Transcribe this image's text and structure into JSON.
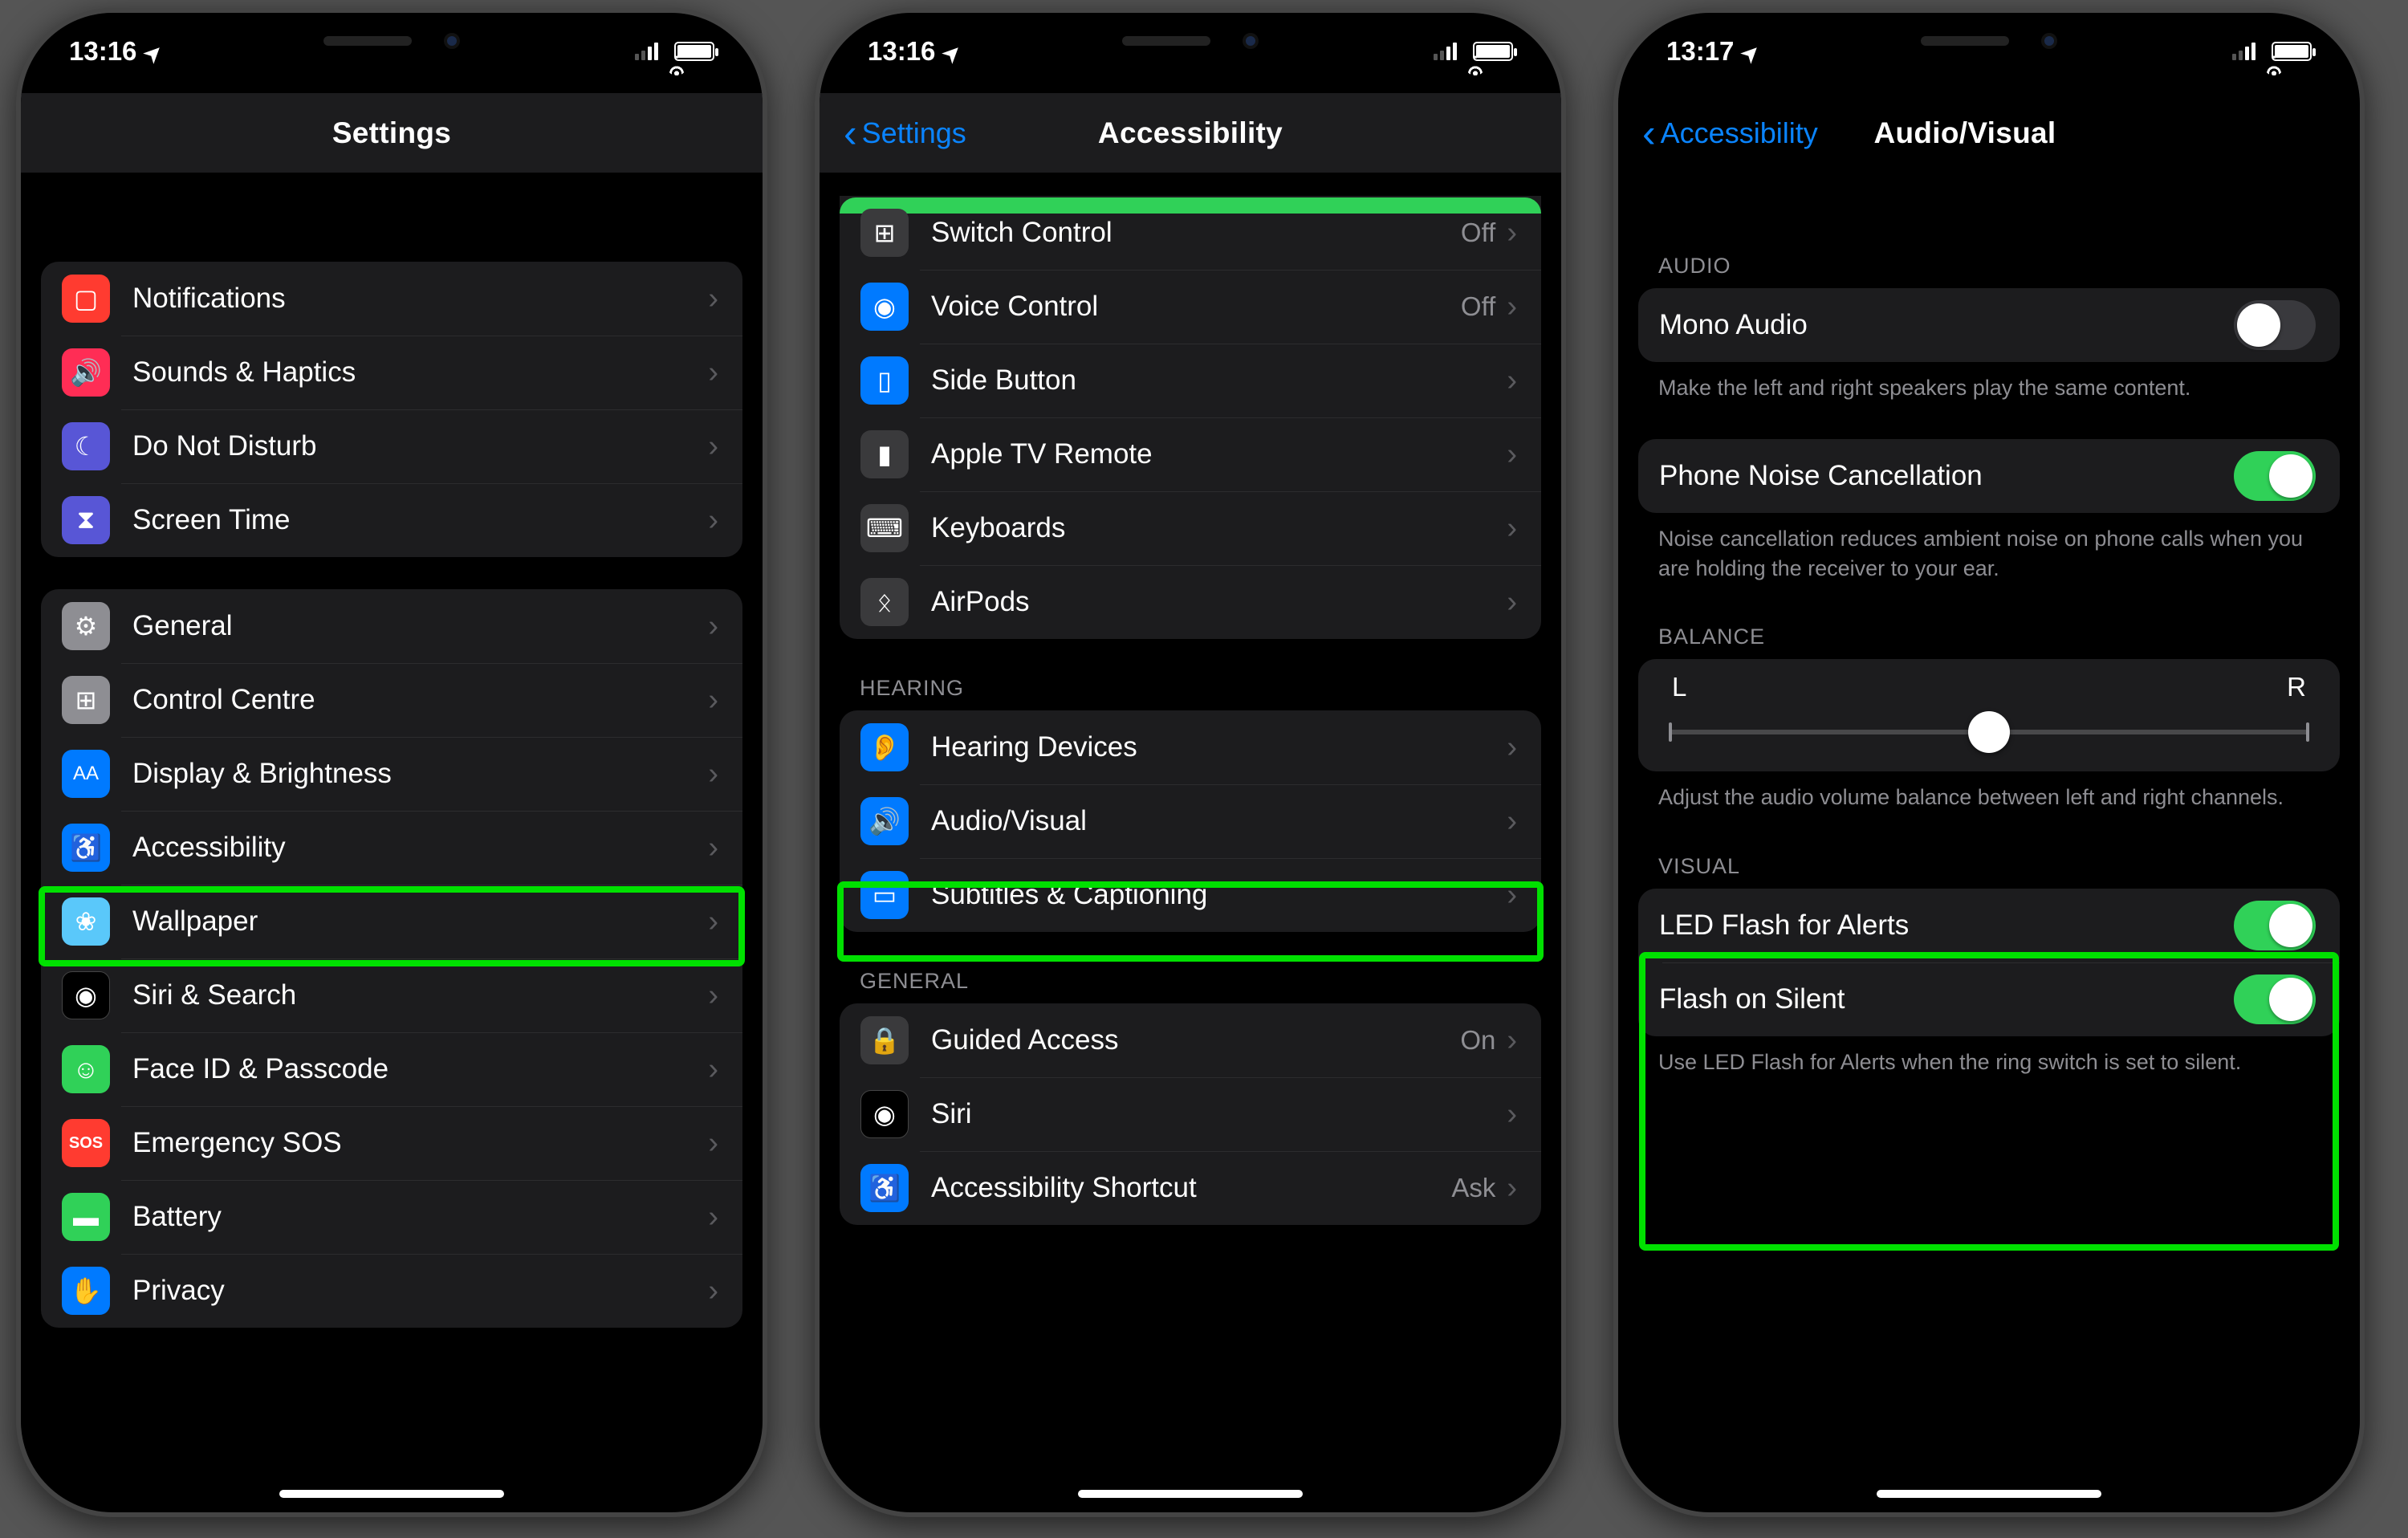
{
  "status": {
    "time1": "13:16",
    "time2": "13:16",
    "time3": "13:17"
  },
  "screen1": {
    "title": "Settings",
    "g1": [
      {
        "label": "Notifications"
      },
      {
        "label": "Sounds & Haptics"
      },
      {
        "label": "Do Not Disturb"
      },
      {
        "label": "Screen Time"
      }
    ],
    "g2": [
      {
        "label": "General"
      },
      {
        "label": "Control Centre"
      },
      {
        "label": "Display & Brightness"
      },
      {
        "label": "Accessibility"
      },
      {
        "label": "Wallpaper"
      },
      {
        "label": "Siri & Search"
      },
      {
        "label": "Face ID & Passcode"
      },
      {
        "label": "Emergency SOS"
      },
      {
        "label": "Battery"
      },
      {
        "label": "Privacy"
      }
    ]
  },
  "screen2": {
    "back": "Settings",
    "title": "Accessibility",
    "g1": [
      {
        "label": "Switch Control",
        "value": "Off"
      },
      {
        "label": "Voice Control",
        "value": "Off"
      },
      {
        "label": "Side Button"
      },
      {
        "label": "Apple TV Remote"
      },
      {
        "label": "Keyboards"
      },
      {
        "label": "AirPods"
      }
    ],
    "h_hearing": "HEARING",
    "g2": [
      {
        "label": "Hearing Devices"
      },
      {
        "label": "Audio/Visual"
      },
      {
        "label": "Subtitles & Captioning"
      }
    ],
    "h_general": "GENERAL",
    "g3": [
      {
        "label": "Guided Access",
        "value": "On"
      },
      {
        "label": "Siri"
      },
      {
        "label": "Accessibility Shortcut",
        "value": "Ask"
      }
    ]
  },
  "screen3": {
    "back": "Accessibility",
    "title": "Audio/Visual",
    "h_audio": "AUDIO",
    "mono": {
      "label": "Mono Audio",
      "footer": "Make the left and right speakers play the same content."
    },
    "noise": {
      "label": "Phone Noise Cancellation",
      "footer": "Noise cancellation reduces ambient noise on phone calls when you are holding the receiver to your ear."
    },
    "h_balance": "BALANCE",
    "balance": {
      "left": "L",
      "right": "R",
      "footer": "Adjust the audio volume balance between left and right channels."
    },
    "h_visual": "VISUAL",
    "led": {
      "label": "LED Flash for Alerts"
    },
    "flash": {
      "label": "Flash on Silent"
    },
    "visual_footer": "Use LED Flash for Alerts when the ring switch is set to silent."
  }
}
